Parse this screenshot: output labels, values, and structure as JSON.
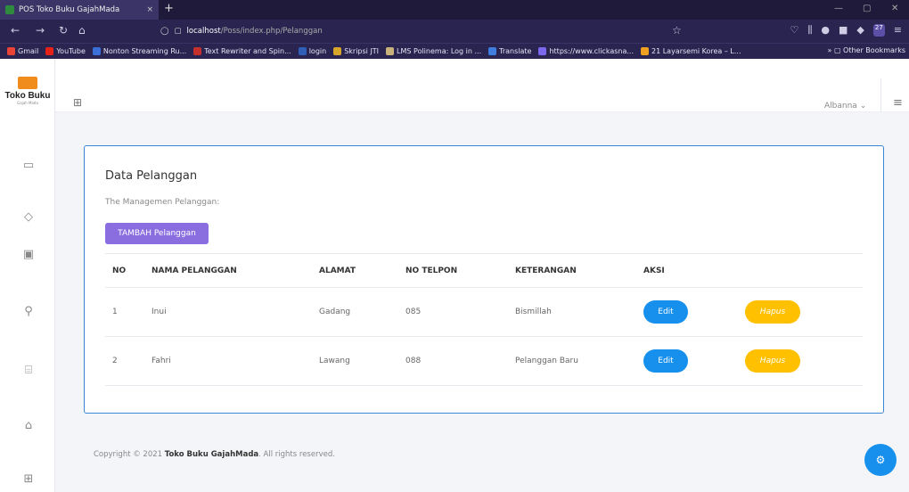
{
  "browser": {
    "tab_title": "POS Toko Buku GajahMada",
    "tab_close": "×",
    "new_tab": "+",
    "url_host": "localhost",
    "url_path": "/Poss/index.php/Pelanggan",
    "badge": "27",
    "bookmarks": [
      {
        "label": "Gmail",
        "color": "#ea4335"
      },
      {
        "label": "YouTube",
        "color": "#e62117"
      },
      {
        "label": "Nonton Streaming Ru...",
        "color": "#3a6fd8"
      },
      {
        "label": "Text Rewriter and Spin...",
        "color": "#c4302b"
      },
      {
        "label": "login",
        "color": "#2f5fb6"
      },
      {
        "label": "Skripsi JTI",
        "color": "#d8a72a"
      },
      {
        "label": "LMS Polinema: Log in ...",
        "color": "#c9b37b"
      },
      {
        "label": "Translate",
        "color": "#3f7ee0"
      },
      {
        "label": "https://www.clickasna...",
        "color": "#7b68ee"
      },
      {
        "label": "21 Layarsemi Korea – L...",
        "color": "#f0a020"
      }
    ],
    "other_bookmarks": "Other Bookmarks"
  },
  "app": {
    "logo_name": "Toko Buku",
    "logo_tag": "Gajah Mada",
    "user_name": "Albanna"
  },
  "card": {
    "title": "Data Pelanggan",
    "subtitle": "The   Managemen Pelanggan:",
    "add_button": "TAMBAH Pelanggan"
  },
  "table": {
    "headers": [
      "NO",
      "NAMA PELANGGAN",
      "ALAMAT",
      "NO TELPON",
      "KETERANGAN",
      "AKSI"
    ],
    "rows": [
      {
        "no": "1",
        "nama": "Inui",
        "alamat": "Gadang",
        "telpon": "085",
        "keterangan": "Bismillah",
        "edit": "Edit",
        "hapus": "Hapus"
      },
      {
        "no": "2",
        "nama": "Fahri",
        "alamat": "Lawang",
        "telpon": "088",
        "keterangan": "Pelanggan Baru",
        "edit": "Edit",
        "hapus": "Hapus"
      }
    ]
  },
  "footer": {
    "prefix": "Copyright © 2021 ",
    "brand": "Toko Buku GajahMada",
    "suffix": ". All rights reserved."
  }
}
